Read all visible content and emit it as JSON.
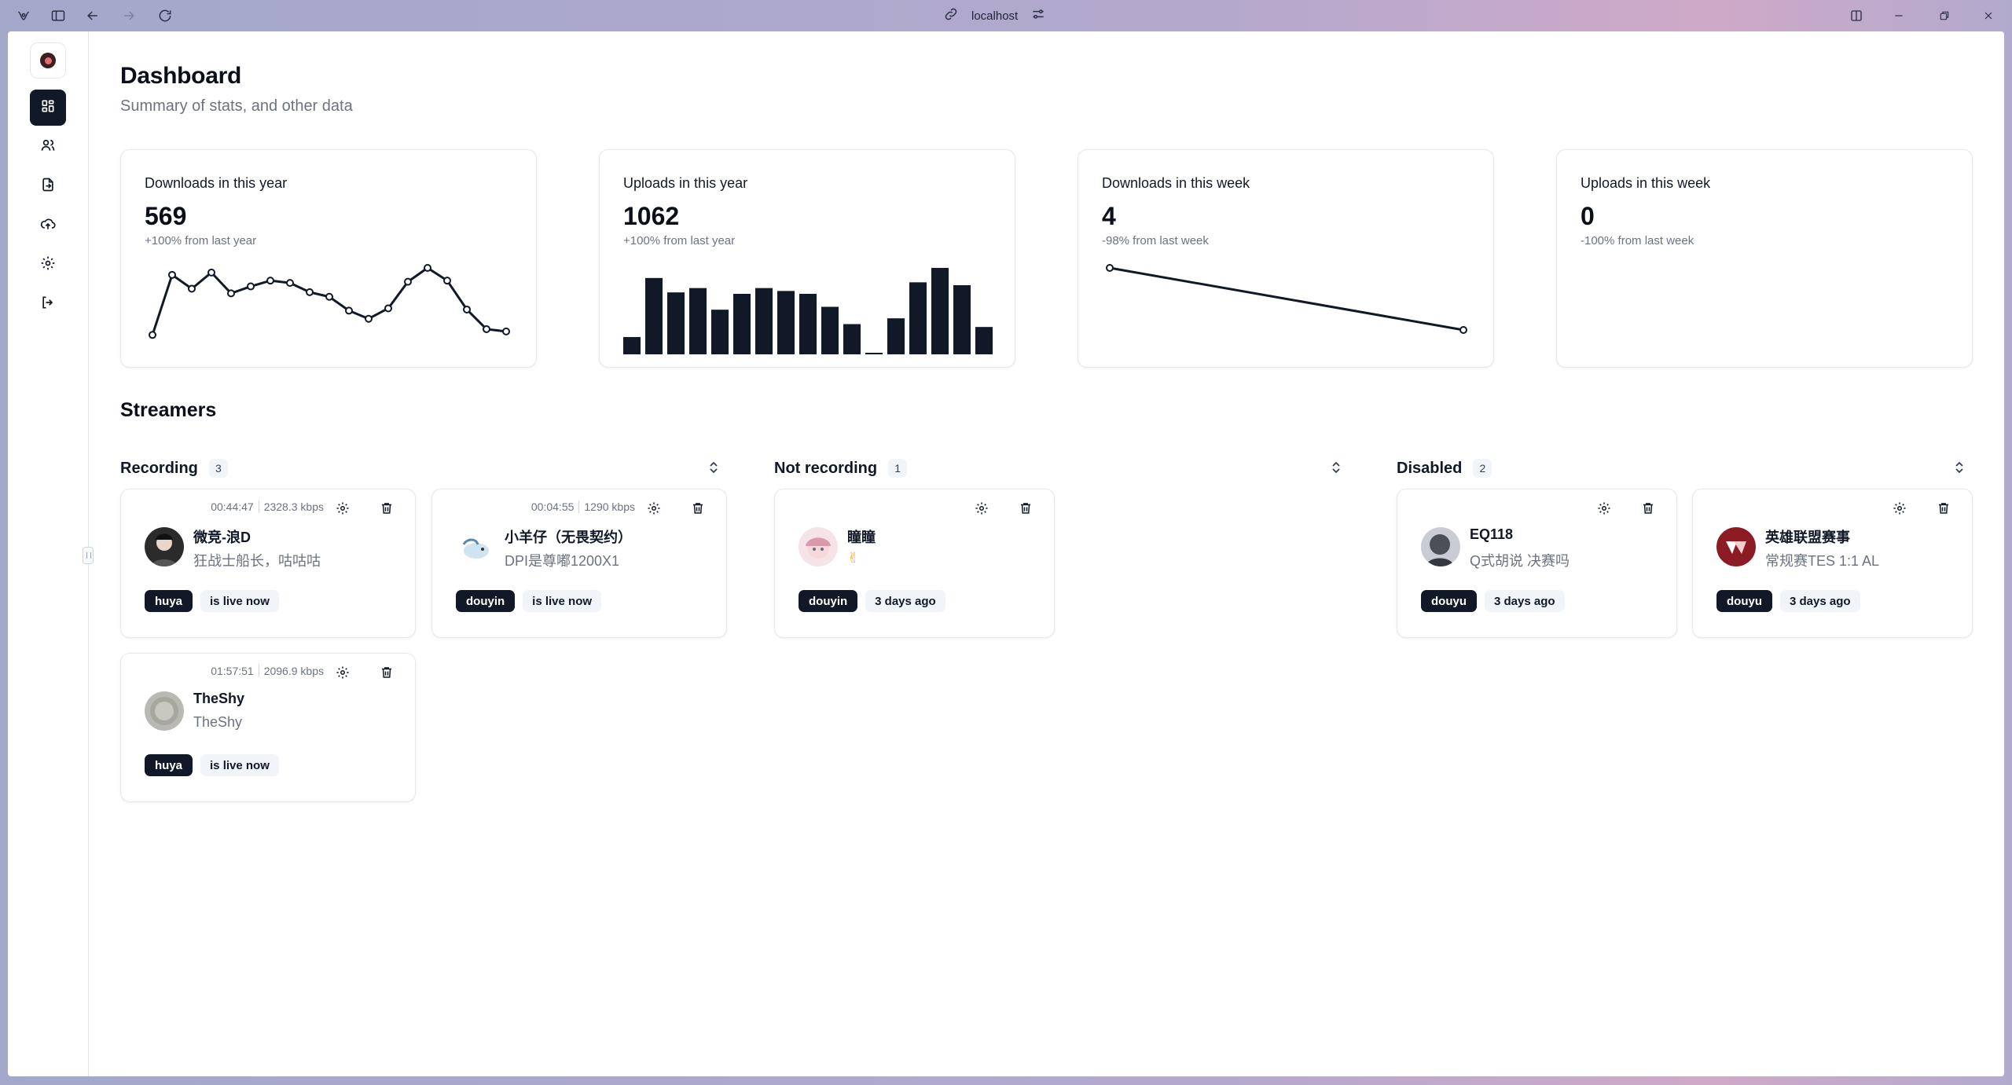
{
  "browser": {
    "url": "localhost"
  },
  "colors": {
    "accent": "#111827",
    "muted": "#6b7280",
    "border": "#e5e7eb",
    "chrome_bg": "#a8aacb"
  },
  "sidebar": {
    "items": [
      {
        "icon": "dashboard-icon",
        "active": true
      },
      {
        "icon": "users-icon",
        "active": false
      },
      {
        "icon": "file-export-icon",
        "active": false
      },
      {
        "icon": "cloud-upload-icon",
        "active": false
      },
      {
        "icon": "gear-icon",
        "active": false
      },
      {
        "icon": "logout-icon",
        "active": false
      }
    ]
  },
  "header": {
    "title": "Dashboard",
    "subtitle": "Summary of stats, and other data"
  },
  "stats": [
    {
      "label": "Downloads in this year",
      "value": "569",
      "delta": "+100% from last year"
    },
    {
      "label": "Uploads in this year",
      "value": "1062",
      "delta": "+100% from last year"
    },
    {
      "label": "Downloads in this week",
      "value": "4",
      "delta": "-98% from last week"
    },
    {
      "label": "Uploads in this week",
      "value": "0",
      "delta": "-100% from last week"
    }
  ],
  "chart_data": [
    {
      "type": "line",
      "values": [
        10,
        62,
        50,
        64,
        46,
        52,
        57,
        55,
        47,
        43,
        31,
        24,
        33,
        56,
        68,
        57,
        32,
        15,
        13
      ]
    },
    {
      "type": "bar",
      "values": [
        12,
        53,
        43,
        46,
        31,
        42,
        46,
        44,
        42,
        33,
        21,
        1,
        25,
        50,
        60,
        48,
        19
      ]
    },
    {
      "type": "line",
      "values": [
        100,
        21
      ]
    },
    {
      "type": "line",
      "values": []
    }
  ],
  "streamers": {
    "title": "Streamers",
    "groups": [
      {
        "name": "Recording",
        "count": "3",
        "cards": [
          {
            "name": "微竞-浪D",
            "desc": "狂战士船长，咕咕咕",
            "duration": "00:44:47",
            "bitrate": "2328.3 kbps",
            "platform": "huya",
            "status": "is live now",
            "avatar": "#2b2b2b"
          },
          {
            "name": "小羊仔（无畏契约）",
            "desc": "DPI是尊嘟1200X1",
            "duration": "00:04:55",
            "bitrate": "1290 kbps",
            "platform": "douyin",
            "status": "is live now",
            "avatar": "#9fc3d9"
          },
          {
            "name": "TheShy",
            "desc": "TheShy",
            "duration": "01:57:51",
            "bitrate": "2096.9 kbps",
            "platform": "huya",
            "status": "is live now",
            "avatar": "#b9b9b3"
          }
        ]
      },
      {
        "name": "Not recording",
        "count": "1",
        "cards": [
          {
            "name": "瞳瞳",
            "desc": "✌",
            "platform": "douyin",
            "status": "3 days ago",
            "avatar": "#e8b8c3"
          }
        ]
      },
      {
        "name": "Disabled",
        "count": "2",
        "cards": [
          {
            "name": "EQ118",
            "desc": "Q式胡说 决赛吗",
            "platform": "douyu",
            "status": "3 days ago",
            "avatar": "#6b6f77"
          },
          {
            "name": "英雄联盟赛事",
            "desc": "常规赛TES 1:1 AL",
            "platform": "douyu",
            "status": "3 days ago",
            "avatar": "#8d1b24"
          }
        ]
      }
    ]
  }
}
